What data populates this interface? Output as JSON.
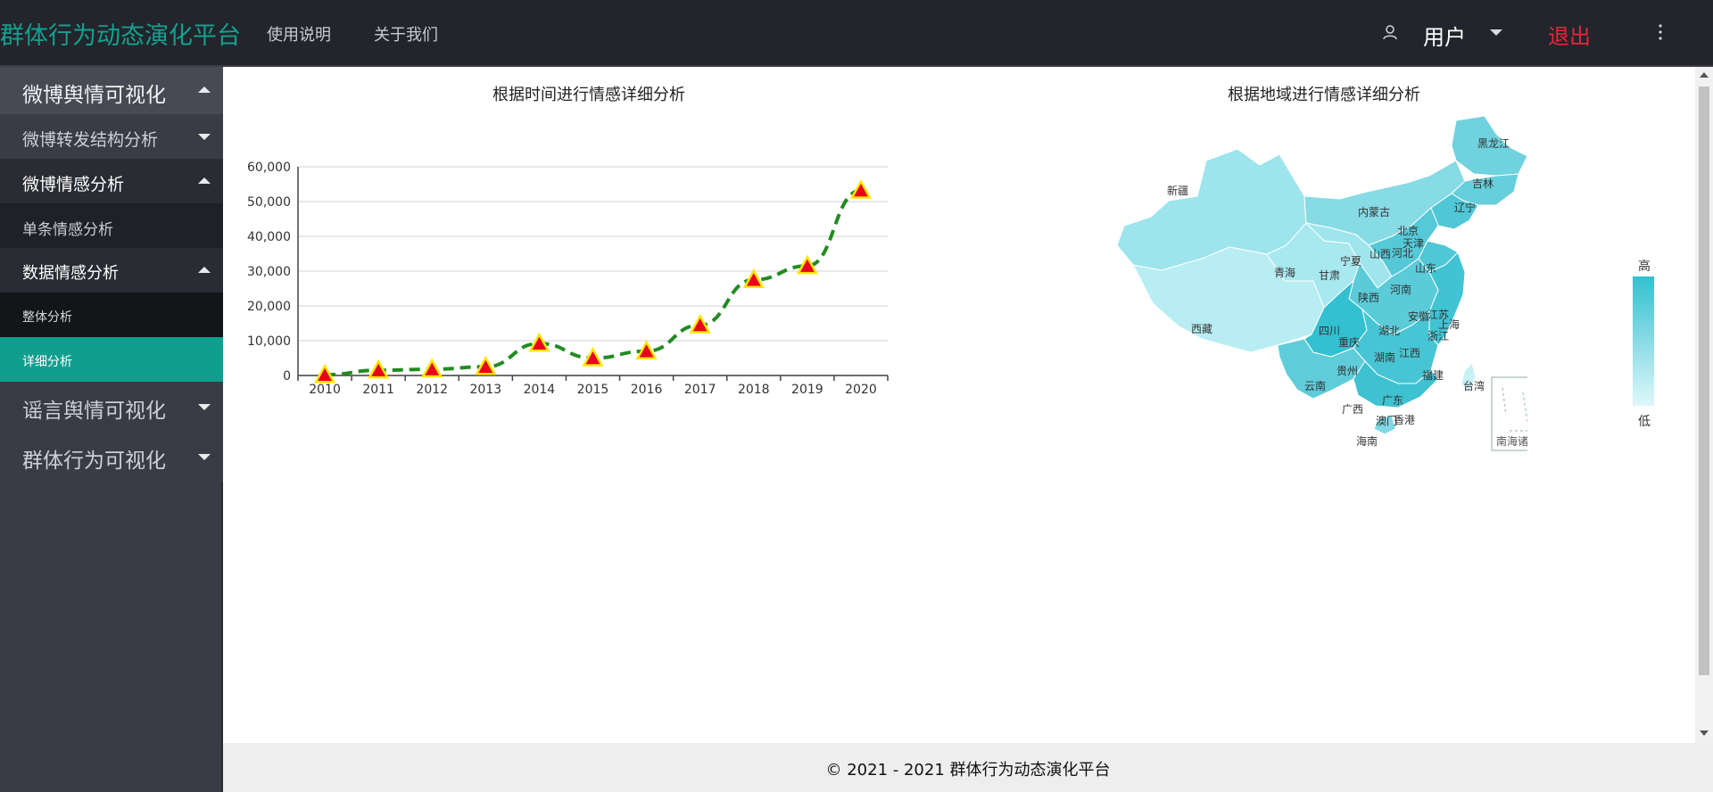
{
  "header": {
    "brand": "群体行为动态演化平台",
    "nav": [
      "使用说明",
      "关于我们"
    ],
    "user_label": "用户",
    "logout_label": "退出"
  },
  "sidebar": {
    "items": [
      {
        "label": "微博舆情可视化",
        "expanded": true
      },
      {
        "label": "微博转发结构分析",
        "expanded": false
      },
      {
        "label": "微博情感分析",
        "expanded": true
      },
      {
        "label": "单条情感分析"
      },
      {
        "label": "数据情感分析",
        "expanded": true
      },
      {
        "label": "整体分析"
      },
      {
        "label": "详细分析",
        "active": true
      },
      {
        "label": "谣言舆情可视化",
        "expanded": false
      },
      {
        "label": "群体行为可视化",
        "expanded": false
      }
    ]
  },
  "main": {
    "time_chart_title": "根据时间进行情感详细分析",
    "region_chart_title": "根据地域进行情感详细分析",
    "legend_high": "高",
    "legend_low": "低",
    "map_inset_label": "南海诸岛"
  },
  "chart_data": [
    {
      "type": "line",
      "title": "根据时间进行情感详细分析",
      "x": [
        "2010",
        "2011",
        "2012",
        "2013",
        "2014",
        "2015",
        "2016",
        "2017",
        "2018",
        "2019",
        "2020"
      ],
      "y_ticks": [
        "0",
        "10,000",
        "20,000",
        "30,000",
        "40,000",
        "50,000",
        "60,000"
      ],
      "ylim": [
        0,
        60000
      ],
      "series": [
        {
          "values": [
            200,
            1500,
            1800,
            2500,
            9200,
            5000,
            7000,
            14500,
            27500,
            31500,
            53200
          ]
        }
      ],
      "line_color": "#228b22",
      "marker": "triangle",
      "marker_fill": "#e8001c",
      "marker_stroke": "#ffe600",
      "grid": true
    },
    {
      "type": "map",
      "title": "根据地域进行情感详细分析",
      "color_low": "#dff7fa",
      "color_high": "#33c0d0",
      "regions": [
        {
          "name": "黑龙江",
          "level": 0.55
        },
        {
          "name": "吉林",
          "level": 0.6
        },
        {
          "name": "辽宁",
          "level": 0.75
        },
        {
          "name": "内蒙古",
          "level": 0.55
        },
        {
          "name": "新疆",
          "level": 0.4
        },
        {
          "name": "青海",
          "level": 0.35
        },
        {
          "name": "西藏",
          "level": 0.2
        },
        {
          "name": "甘肃",
          "level": 0.45
        },
        {
          "name": "宁夏",
          "level": 0.5
        },
        {
          "name": "北京",
          "level": 0.8
        },
        {
          "name": "天津",
          "level": 0.7
        },
        {
          "name": "河北",
          "level": 0.7
        },
        {
          "name": "山西",
          "level": 0.65
        },
        {
          "name": "山东",
          "level": 0.75
        },
        {
          "name": "陕西",
          "level": 0.65
        },
        {
          "name": "河南",
          "level": 0.75
        },
        {
          "name": "四川",
          "level": 0.85
        },
        {
          "name": "重庆",
          "level": 0.7
        },
        {
          "name": "湖北",
          "level": 0.75
        },
        {
          "name": "安徽",
          "level": 0.7
        },
        {
          "name": "江苏",
          "level": 0.8
        },
        {
          "name": "上海",
          "level": 0.75
        },
        {
          "name": "浙江",
          "level": 0.85
        },
        {
          "name": "湖南",
          "level": 0.8
        },
        {
          "name": "江西",
          "level": 0.7
        },
        {
          "name": "贵州",
          "level": 0.65
        },
        {
          "name": "云南",
          "level": 0.7
        },
        {
          "name": "福建",
          "level": 0.75
        },
        {
          "name": "广西",
          "level": 0.6
        },
        {
          "name": "广东",
          "level": 0.85
        },
        {
          "name": "澳门",
          "level": 0.5
        },
        {
          "name": "香港",
          "level": 0.5
        },
        {
          "name": "台湾",
          "level": 0.2
        },
        {
          "name": "海南",
          "level": 0.55
        }
      ]
    }
  ],
  "footer": {
    "text": "© 2021 - 2021 群体行为动态演化平台"
  }
}
